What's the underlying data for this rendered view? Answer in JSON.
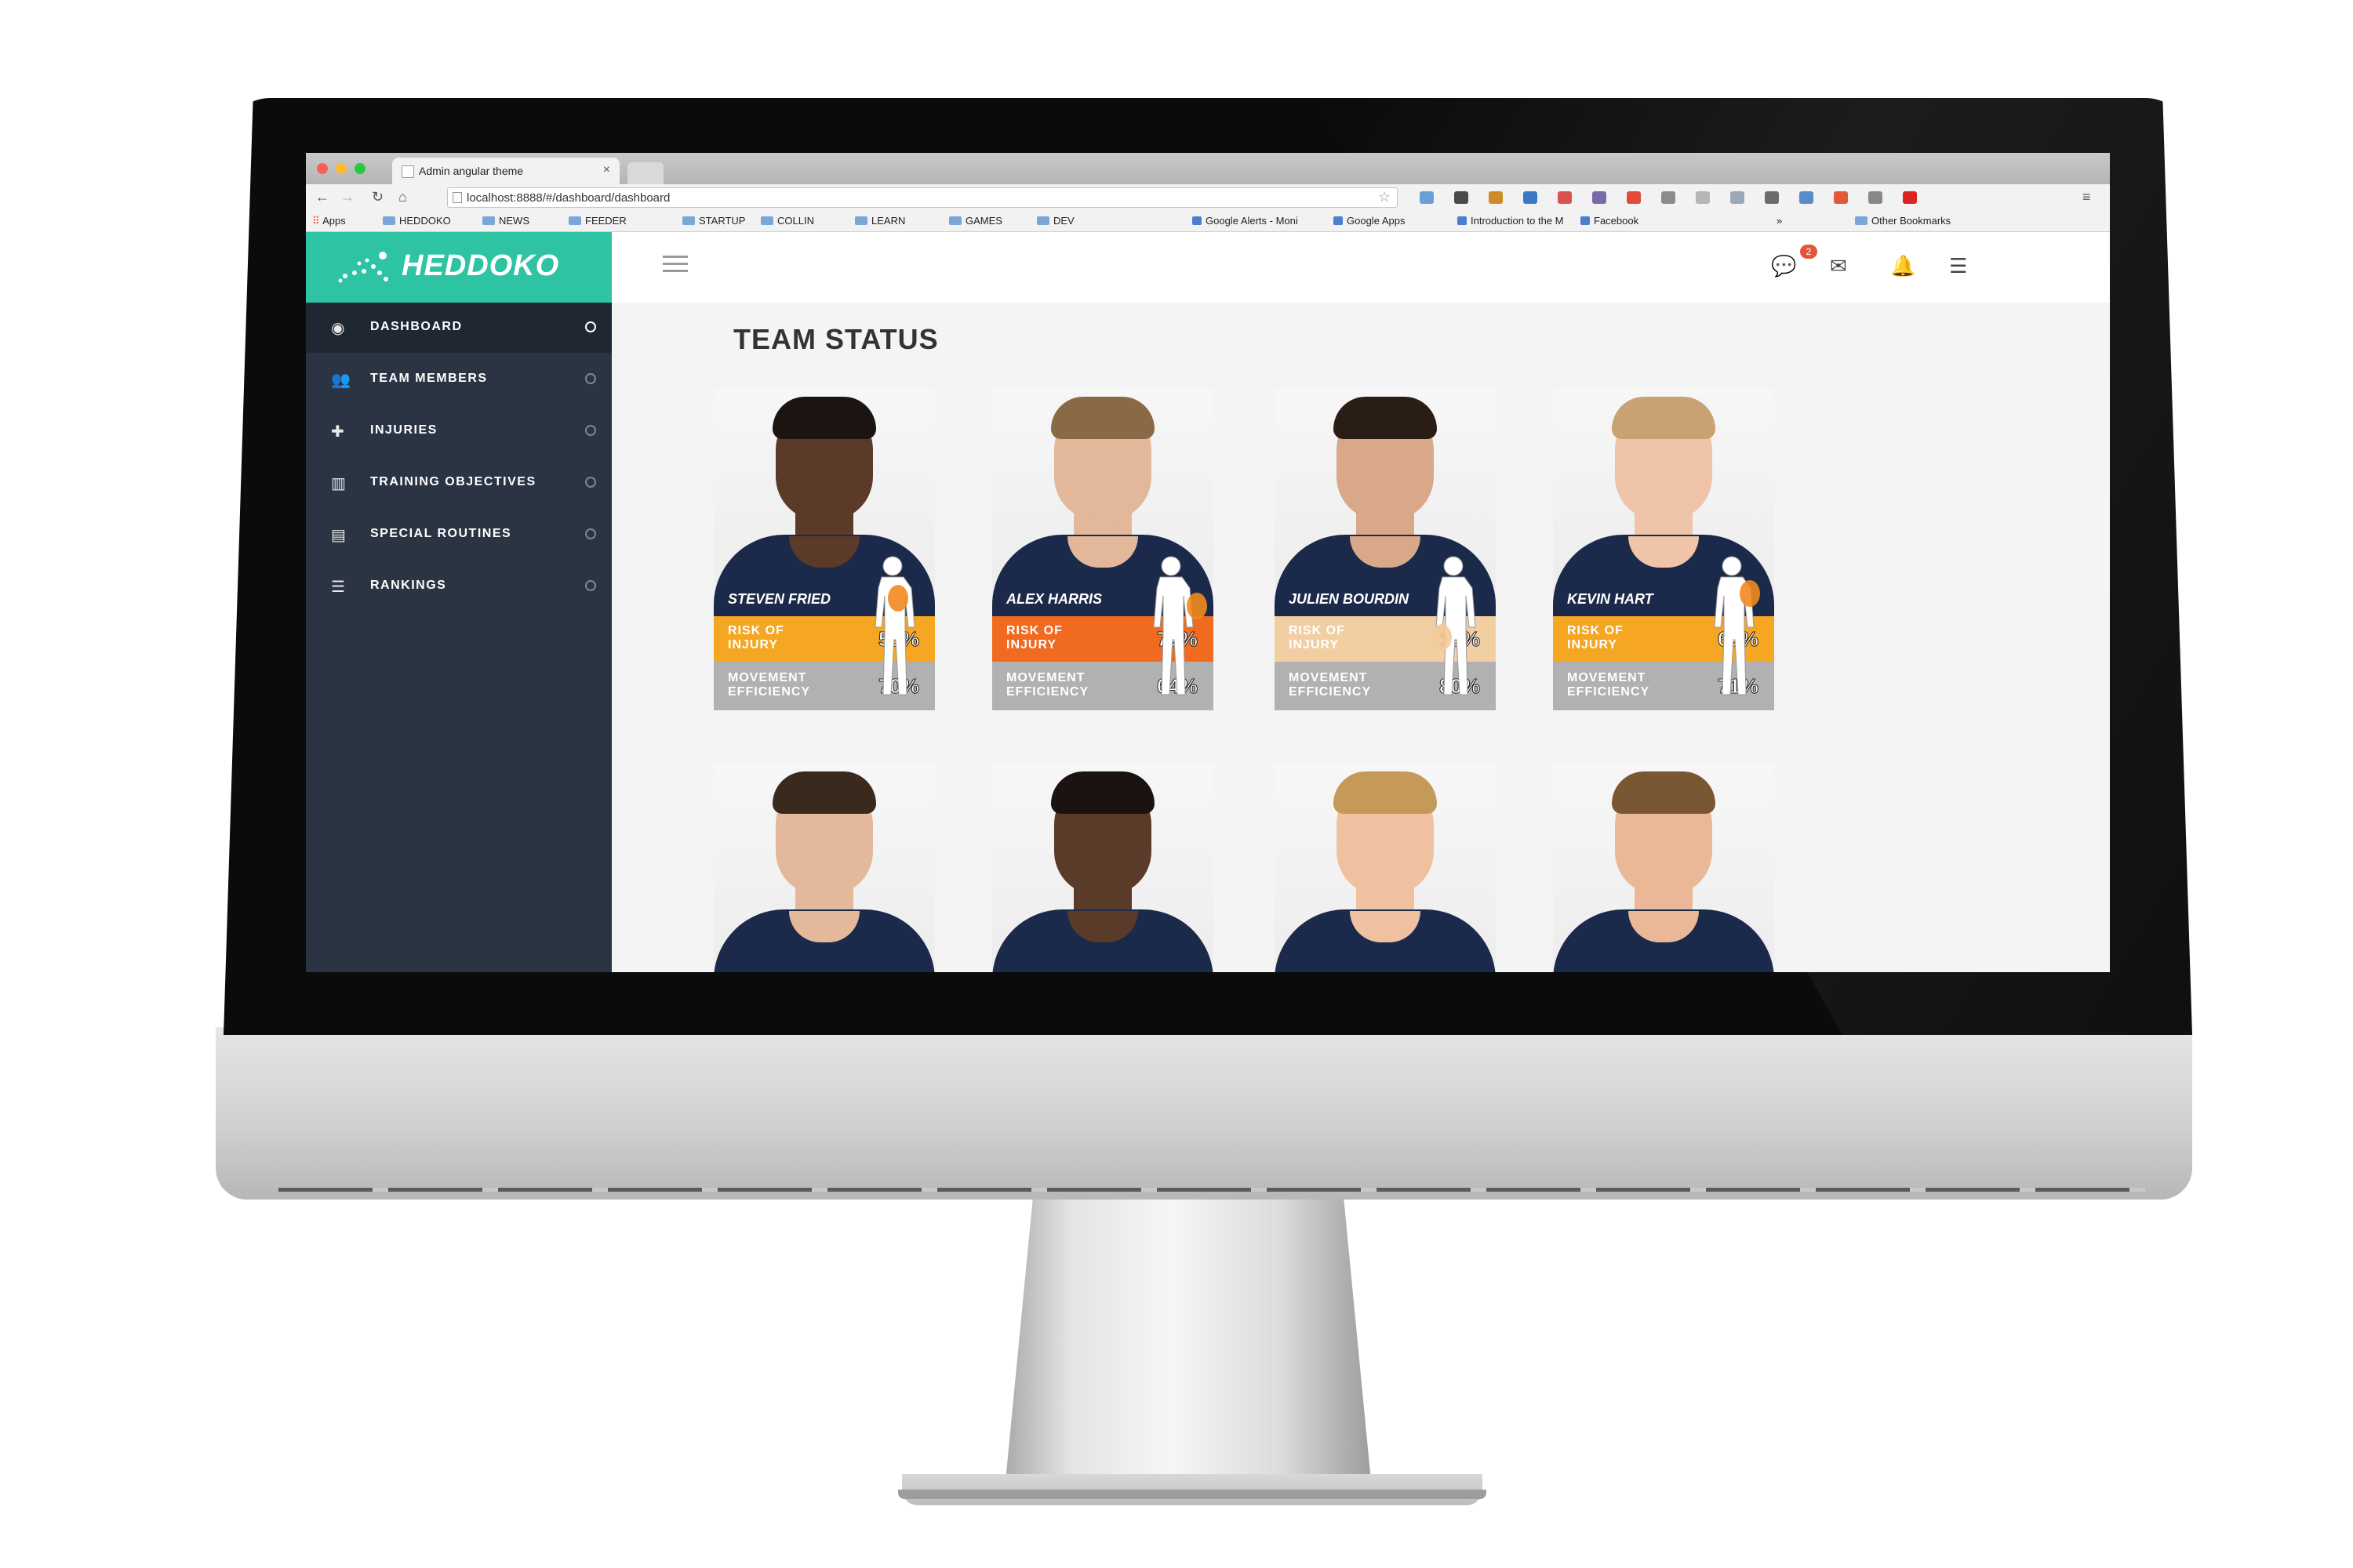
{
  "browser": {
    "tab_title": "Admin angular theme",
    "tab_close": "×",
    "url": "localhost:8888/#/dashboard/dashboard",
    "bookmarks": [
      {
        "label": "Apps",
        "type": "apps"
      },
      {
        "label": "HEDDOKO",
        "type": "folder"
      },
      {
        "label": "NEWS",
        "type": "folder"
      },
      {
        "label": "FEEDER",
        "type": "folder"
      },
      {
        "label": "STARTUP",
        "type": "folder"
      },
      {
        "label": "COLLIN",
        "type": "folder"
      },
      {
        "label": "LEARN",
        "type": "folder"
      },
      {
        "label": "GAMES",
        "type": "folder"
      },
      {
        "label": "DEV",
        "type": "folder"
      },
      {
        "label": "Google Alerts - Moni",
        "type": "page"
      },
      {
        "label": "Google Apps",
        "type": "page"
      },
      {
        "label": "Introduction to the M",
        "type": "page"
      },
      {
        "label": "Facebook",
        "type": "page"
      },
      {
        "label": "»",
        "type": "overflow"
      },
      {
        "label": "Other Bookmarks",
        "type": "folder"
      }
    ]
  },
  "app": {
    "brand": "HEDDOKO",
    "brand_color": "#2ec4a3",
    "messages_badge": "2",
    "sidebar": [
      {
        "label": "DASHBOARD",
        "icon": "dashboard-icon",
        "glyph": "◉",
        "active": true
      },
      {
        "label": "TEAM MEMBERS",
        "icon": "users-icon",
        "glyph": "👥",
        "active": false
      },
      {
        "label": "INJURIES",
        "icon": "medkit-icon",
        "glyph": "✚",
        "active": false
      },
      {
        "label": "TRAINING OBJECTIVES",
        "icon": "bar-chart-icon",
        "glyph": "▥",
        "active": false
      },
      {
        "label": "SPECIAL ROUTINES",
        "icon": "card-icon",
        "glyph": "▤",
        "active": false
      },
      {
        "label": "RANKINGS",
        "icon": "list-icon",
        "glyph": "☰",
        "active": false
      }
    ],
    "page_title": "TEAM STATUS",
    "risk_label": "RISK OF INJURY",
    "movement_label": "MOVEMENT EFFICIENCY",
    "players": [
      {
        "name": "STEVEN FRIED",
        "risk": "53%",
        "movement": "70%",
        "risk_color": "#f5a623",
        "skin": "#5b3a29",
        "hair": "#1c1410"
      },
      {
        "name": "ALEX HARRIS",
        "risk": "72%",
        "movement": "64%",
        "risk_color": "#f06a1f",
        "skin": "#e3b79a",
        "hair": "#8a6a45"
      },
      {
        "name": "JULIEN BOURDIN",
        "risk": "13%",
        "movement": "80%",
        "risk_color": "#f2cfa3",
        "skin": "#d9a889",
        "hair": "#2a1d16"
      },
      {
        "name": "KEVIN HART",
        "risk": "62%",
        "movement": "71%",
        "risk_color": "#f5a623",
        "skin": "#efc4a8",
        "hair": "#c9a273"
      },
      {
        "name": "",
        "skin": "#e4b89b",
        "hair": "#3a2a1e"
      },
      {
        "name": "",
        "skin": "#5a3a28",
        "hair": "#1a1310"
      },
      {
        "name": "",
        "skin": "#f0c1a1",
        "hair": "#c59a58"
      },
      {
        "name": "",
        "skin": "#eab896",
        "hair": "#7a5733"
      }
    ]
  }
}
